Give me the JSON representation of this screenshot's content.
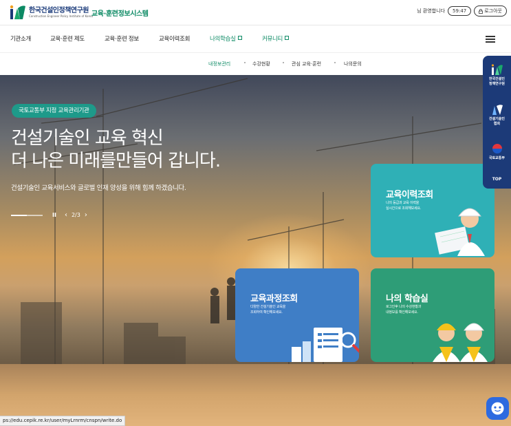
{
  "header": {
    "logo_name": "한국건설인정책연구원",
    "logo_sub": "Construction Engineer Policy Institute of Korea",
    "system_title": "교육·훈련정보시스템",
    "user_greeting": "님 환영합니다",
    "timer": "59:47",
    "logout_label": "로그아웃"
  },
  "gnb": {
    "items": [
      {
        "label": "기관소개"
      },
      {
        "label": "교육·훈련 제도"
      },
      {
        "label": "교육·훈련 정보"
      },
      {
        "label": "교육이력조회"
      },
      {
        "label": "나의학습실"
      },
      {
        "label": "커뮤니티"
      }
    ]
  },
  "subnav": {
    "items": [
      {
        "label": "내정보관리"
      },
      {
        "label": "수강현황"
      },
      {
        "label": "관심 교육·훈련"
      },
      {
        "label": "나의문의"
      }
    ]
  },
  "hero": {
    "badge": "국토교통부 지정 교육관리기관",
    "title_line1": "건설기술인 교육 혁신",
    "title_line2": "더 나은 미래를만들어 갑니다.",
    "description": "건설기술인 교육서비스와 글로벌 인재 양성을 위해 힘께 하겠습니다.",
    "slide_indicator": "2/3",
    "pause_symbol": "II",
    "prev_symbol": "‹",
    "next_symbol": "›"
  },
  "cards": {
    "history": {
      "title": "교육이력조회",
      "desc_line1": "나의 등급과 교육 이력을",
      "desc_line2": "실시간으로 조회해보세요."
    },
    "course": {
      "title": "교육과정조회",
      "desc_line1": "다양한 건설기술인 교육을",
      "desc_line2": "조회하여 확인해보세요."
    },
    "study": {
      "title": "나의 학습실",
      "desc_line1": "로그인후 나의 수강현황과",
      "desc_line2": "내정보를 확인해보세요."
    }
  },
  "quickbar": {
    "item1_line1": "한국건설인",
    "item1_line2": "정책연구원",
    "item2_line1": "건설기술인",
    "item2_line2": "협회",
    "item3": "국토교통부",
    "top": "TOP"
  },
  "status_url": "ps://edu.cepik.re.kr/user/myLrnrm/cnspn/write.do",
  "colors": {
    "brand_green": "#0c8a64",
    "navy": "#1c3a78",
    "card_teal": "#2fb0b6",
    "card_blue": "#3f7ec6",
    "card_green": "#2e9d77"
  }
}
